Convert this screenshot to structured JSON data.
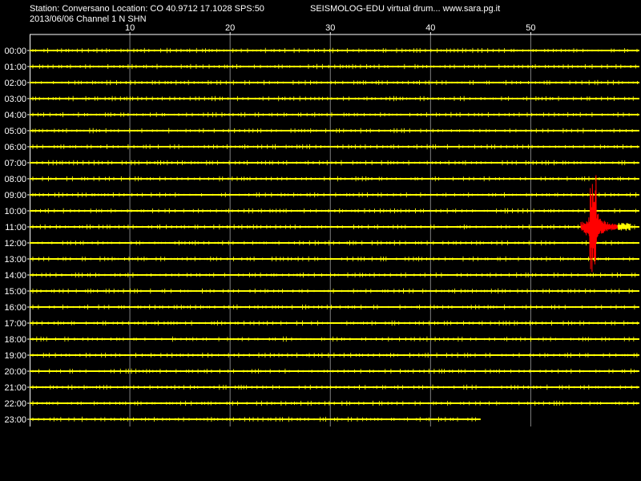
{
  "header": {
    "station_line": "Station: Conversano Location: CO 40.9712 17.1028 SPS:50",
    "brand_line": "SEISMOLOG-EDU virtual drum... www.sara.pg.it",
    "date_line": "2013/06/06  Channel 1 N SHN"
  },
  "colors": {
    "background": "#000000",
    "text": "#ffffff",
    "axis": "#ffffff",
    "grid": "#808080",
    "trace": "#ffff00",
    "event": "#ff0000"
  },
  "chart_data": {
    "type": "line",
    "x_ticks": [
      10,
      20,
      30,
      40,
      50
    ],
    "xlim": [
      0,
      61
    ],
    "grid": true,
    "rows": [
      "00:00",
      "01:00",
      "02:00",
      "03:00",
      "04:00",
      "05:00",
      "06:00",
      "07:00",
      "08:00",
      "09:00",
      "10:00",
      "11:00",
      "12:00",
      "13:00",
      "14:00",
      "15:00",
      "16:00",
      "17:00",
      "18:00",
      "19:00",
      "20:00",
      "21:00",
      "22:00",
      "23:00"
    ],
    "last_row_end_minute": 45,
    "event": {
      "row": "11:00",
      "start_minute": 55,
      "end_minute": 59.5,
      "peak_minute": 56.2,
      "peak_rows_up": 3.8,
      "peak_rows_down": 3.8
    }
  }
}
